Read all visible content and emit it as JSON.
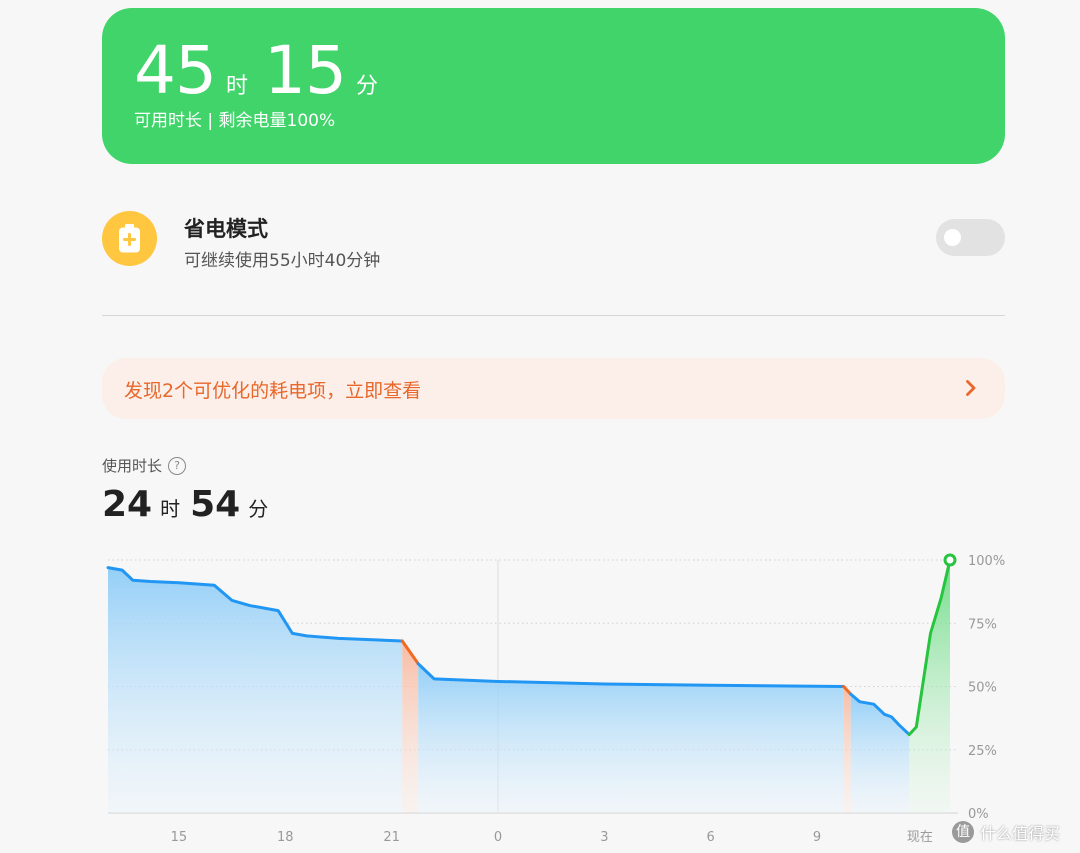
{
  "battery": {
    "hours": "45",
    "hour_unit": "时",
    "minutes": "15",
    "minute_unit": "分",
    "subtitle": "可用时长 | 剩余电量100%"
  },
  "power_saving": {
    "icon": "battery-plus-icon",
    "title": "省电模式",
    "subtitle": "可继续使用55小时40分钟",
    "toggle_on": false
  },
  "optimization": {
    "text": "发现2个可优化的耗电项，立即查看",
    "icon": "chevron-right-icon"
  },
  "usage": {
    "label": "使用时长",
    "help_icon": "?",
    "hours": "24",
    "hour_unit": "时",
    "minutes": "54",
    "minute_unit": "分"
  },
  "colors": {
    "card_green": "#41d46a",
    "accent_orange": "#e8672a",
    "line_blue": "#2196f3",
    "charge_green": "#27c440",
    "drain_orange": "#f06a24"
  },
  "chart_data": {
    "type": "area",
    "ylabel": "",
    "xlabel": "",
    "y_ticks": [
      "100%",
      "75%",
      "50%",
      "25%",
      "0%"
    ],
    "ylim": [
      0,
      100
    ],
    "x_ticks": [
      "15",
      "18",
      "21",
      "0",
      "3",
      "6",
      "9",
      "现在"
    ],
    "grid": true,
    "series": [
      {
        "segment": "discharge",
        "points": [
          [
            13.0,
            97
          ],
          [
            13.4,
            96
          ],
          [
            13.7,
            92
          ],
          [
            14.2,
            91.5
          ],
          [
            15.0,
            91
          ],
          [
            16.0,
            90
          ],
          [
            16.5,
            84
          ],
          [
            17.0,
            82
          ],
          [
            17.8,
            80
          ],
          [
            18.2,
            71
          ],
          [
            18.6,
            70
          ],
          [
            19.5,
            69
          ],
          [
            21.3,
            68
          ]
        ]
      },
      {
        "segment": "rapid-drain",
        "points": [
          [
            21.3,
            68
          ],
          [
            21.75,
            59
          ]
        ]
      },
      {
        "segment": "discharge",
        "points": [
          [
            21.75,
            59
          ],
          [
            22.2,
            53
          ],
          [
            24.0,
            52
          ],
          [
            27.0,
            51
          ],
          [
            30.0,
            50.5
          ],
          [
            33.75,
            50
          ]
        ]
      },
      {
        "segment": "rapid-drain",
        "points": [
          [
            33.75,
            50
          ],
          [
            33.95,
            47
          ]
        ]
      },
      {
        "segment": "discharge",
        "points": [
          [
            33.95,
            47
          ],
          [
            34.2,
            44
          ],
          [
            34.6,
            43
          ],
          [
            34.9,
            39
          ],
          [
            35.1,
            38
          ],
          [
            35.3,
            35
          ],
          [
            35.6,
            31
          ]
        ]
      },
      {
        "segment": "charging",
        "points": [
          [
            35.6,
            31
          ],
          [
            35.8,
            34
          ],
          [
            36.2,
            71
          ],
          [
            36.5,
            85
          ],
          [
            36.75,
            100
          ]
        ]
      }
    ],
    "current_value": 100
  }
}
